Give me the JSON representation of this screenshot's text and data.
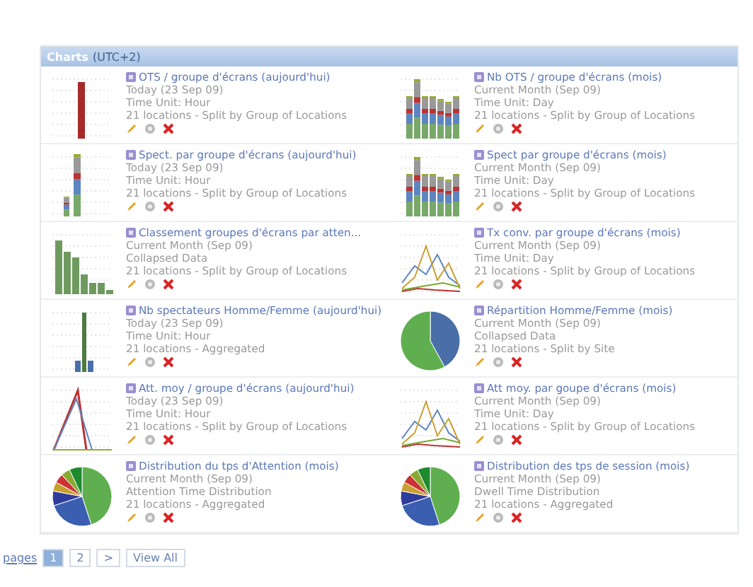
{
  "panel": {
    "title": "Charts",
    "timezone": "(UTC+2)"
  },
  "charts": [
    {
      "kind": "single-bar",
      "title": "OTS / groupe d'écrans (aujourd'hui)",
      "lines": [
        "Today (23 Sep 09)",
        "Time Unit: Hour",
        "21 locations - Split by Group of Locations"
      ]
    },
    {
      "kind": "stacked",
      "title": "Nb OTS / groupe d'écrans (mois)",
      "lines": [
        "Current Month (Sep 09)",
        "Time Unit: Day",
        "21 locations - Split by Group of Locations"
      ]
    },
    {
      "kind": "stacked-tall",
      "title": "Spect. par groupe d'écrans (aujourd'hui)",
      "lines": [
        "Today (23 Sep 09)",
        "Time Unit: Hour",
        "21 locations - Split by Group of Locations"
      ]
    },
    {
      "kind": "stacked",
      "title": "Spect par groupe d'écrans (mois)",
      "lines": [
        "Current Month (Sep 09)",
        "Time Unit: Day",
        "21 locations - Split by Group of Locations"
      ]
    },
    {
      "kind": "descending",
      "title": "Classement groupes d'écrans par atten...",
      "lines": [
        "Current Month (Sep 09)",
        "Collapsed Data",
        "21 locations - Split by Group of Locations"
      ]
    },
    {
      "kind": "line",
      "title": "Tx conv. par groupe d'écrans (mois)",
      "lines": [
        "Current Month (Sep 09)",
        "Time Unit: Day",
        "21 locations - Split by Group of Locations"
      ]
    },
    {
      "kind": "thin-bar",
      "title": "Nb spectateurs Homme/Femme (aujourd'hui)",
      "lines": [
        "Today (23 Sep 09)",
        "Time Unit: Hour",
        "21 locations - Aggregated"
      ]
    },
    {
      "kind": "pie-two",
      "title": "Répartition Homme/Femme (mois)",
      "lines": [
        "Current Month (Sep 09)",
        "Collapsed Data",
        "21 locations - Split by Site"
      ]
    },
    {
      "kind": "peak",
      "title": "Att. moy / groupe d'écrans (aujourd'hui)",
      "lines": [
        "Today (23 Sep 09)",
        "Time Unit: Hour",
        "21 locations - Split by Group of Locations"
      ]
    },
    {
      "kind": "line",
      "title": "Att moy. par goupe d'écrans (mois)",
      "lines": [
        "Current Month (Sep 09)",
        "Time Unit: Day",
        "21 locations - Split by Group of Locations"
      ]
    },
    {
      "kind": "pie-many",
      "title": "Distribution du tps d'Attention (mois)",
      "lines": [
        "Current Month (Sep 09)",
        "Attention Time Distribution",
        "21 locations - Aggregated"
      ]
    },
    {
      "kind": "pie-many",
      "title": "Distribution des tps de session (mois)",
      "lines": [
        "Current Month (Sep 09)",
        "Dwell Time Distribution",
        "21 locations - Aggregated"
      ]
    }
  ],
  "pagination": {
    "summary": "pages",
    "pages": [
      {
        "label": "1",
        "selected": true
      },
      {
        "label": "2",
        "selected": false
      }
    ],
    "next": ">",
    "view_all": "View All"
  }
}
